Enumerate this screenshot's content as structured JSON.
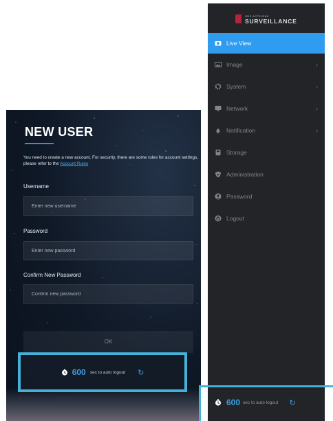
{
  "login": {
    "title": "NEW USER",
    "description": "You need to create a new account. For security, there are some rules for account settings, please refer to the ",
    "rules_link": "Account Rules",
    "username_label": "Username",
    "username_placeholder": "Enter new username",
    "password_label": "Password",
    "password_placeholder": "Enter new password",
    "confirm_label": "Confirm New Password",
    "confirm_placeholder": "Confirm new password",
    "ok_label": "OK",
    "auto_logout": {
      "seconds": "600",
      "text": "sec to auto logout"
    }
  },
  "nav": {
    "brand_small": "IDIS ACTIVEBK",
    "brand_name": "SURVEILLANCE",
    "items": [
      {
        "label": "Live View",
        "icon": "camera-icon",
        "active": true,
        "submenu": false
      },
      {
        "label": "Image",
        "icon": "image-icon",
        "active": false,
        "submenu": true
      },
      {
        "label": "System",
        "icon": "gear-icon",
        "active": false,
        "submenu": true
      },
      {
        "label": "Network",
        "icon": "monitor-icon",
        "active": false,
        "submenu": true
      },
      {
        "label": "Notification",
        "icon": "bell-icon",
        "active": false,
        "submenu": true
      },
      {
        "label": "Storage",
        "icon": "storage-icon",
        "active": false,
        "submenu": false
      },
      {
        "label": "Administration",
        "icon": "shield-icon",
        "active": false,
        "submenu": false
      },
      {
        "label": "Password",
        "icon": "user-icon",
        "active": false,
        "submenu": false
      },
      {
        "label": "Logout",
        "icon": "power-icon",
        "active": false,
        "submenu": false
      }
    ],
    "auto_logout": {
      "seconds": "600",
      "text": "sec to auto logout"
    }
  },
  "colors": {
    "accent": "#2f9cef",
    "highlight": "#46b1d8",
    "nav_bg": "#222428"
  }
}
